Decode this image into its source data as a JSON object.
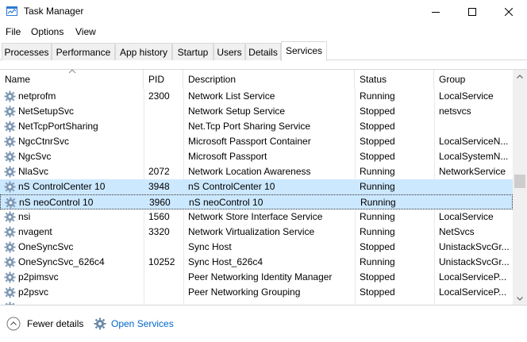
{
  "window": {
    "title": "Task Manager",
    "icons": {
      "app": "task-manager-icon",
      "minimize": "minimize-icon",
      "maximize": "maximize-icon",
      "close": "close-icon"
    }
  },
  "menu": [
    "File",
    "Options",
    "View"
  ],
  "tabs": [
    {
      "label": "Processes",
      "active": false
    },
    {
      "label": "Performance",
      "active": false
    },
    {
      "label": "App history",
      "active": false
    },
    {
      "label": "Startup",
      "active": false
    },
    {
      "label": "Users",
      "active": false
    },
    {
      "label": "Details",
      "active": false
    },
    {
      "label": "Services",
      "active": true
    }
  ],
  "columns": {
    "name": "Name",
    "pid": "PID",
    "description": "Description",
    "status": "Status",
    "group": "Group"
  },
  "rows": [
    {
      "name": "netprofm",
      "pid": "2300",
      "description": "Network List Service",
      "status": "Running",
      "group": "LocalService"
    },
    {
      "name": "NetSetupSvc",
      "pid": "",
      "description": "Network Setup Service",
      "status": "Stopped",
      "group": "netsvcs"
    },
    {
      "name": "NetTcpPortSharing",
      "pid": "",
      "description": "Net.Tcp Port Sharing Service",
      "status": "Stopped",
      "group": ""
    },
    {
      "name": "NgcCtnrSvc",
      "pid": "",
      "description": "Microsoft Passport Container",
      "status": "Stopped",
      "group": "LocalServiceN..."
    },
    {
      "name": "NgcSvc",
      "pid": "",
      "description": "Microsoft Passport",
      "status": "Stopped",
      "group": "LocalSystemN..."
    },
    {
      "name": "NlaSvc",
      "pid": "2072",
      "description": "Network Location Awareness",
      "status": "Running",
      "group": "NetworkService"
    },
    {
      "name": "nS ControlCenter 10",
      "pid": "3948",
      "description": "nS ControlCenter 10",
      "status": "Running",
      "group": "",
      "selected": "hover"
    },
    {
      "name": "nS neoControl 10",
      "pid": "3960",
      "description": "nS neoControl 10",
      "status": "Running",
      "group": "",
      "selected": "focus"
    },
    {
      "name": "nsi",
      "pid": "1560",
      "description": "Network Store Interface Service",
      "status": "Running",
      "group": "LocalService"
    },
    {
      "name": "nvagent",
      "pid": "3320",
      "description": "Network Virtualization Service",
      "status": "Running",
      "group": "NetSvcs"
    },
    {
      "name": "OneSyncSvc",
      "pid": "",
      "description": "Sync Host",
      "status": "Stopped",
      "group": "UnistackSvcGr..."
    },
    {
      "name": "OneSyncSvc_626c4",
      "pid": "10252",
      "description": "Sync Host_626c4",
      "status": "Running",
      "group": "UnistackSvcGr..."
    },
    {
      "name": "p2pimsvc",
      "pid": "",
      "description": "Peer Networking Identity Manager",
      "status": "Stopped",
      "group": "LocalServiceP..."
    },
    {
      "name": "p2psvc",
      "pid": "",
      "description": "Peer Networking Grouping",
      "status": "Stopped",
      "group": "LocalServiceP..."
    },
    {
      "name": "",
      "pid": "",
      "description": "",
      "status": "",
      "group": ""
    }
  ],
  "footer": {
    "fewer_details": "Fewer details",
    "open_services": "Open Services"
  },
  "colors": {
    "selection": "#cce8ff",
    "link": "#0066cc",
    "gear": "#6a8aa8"
  }
}
